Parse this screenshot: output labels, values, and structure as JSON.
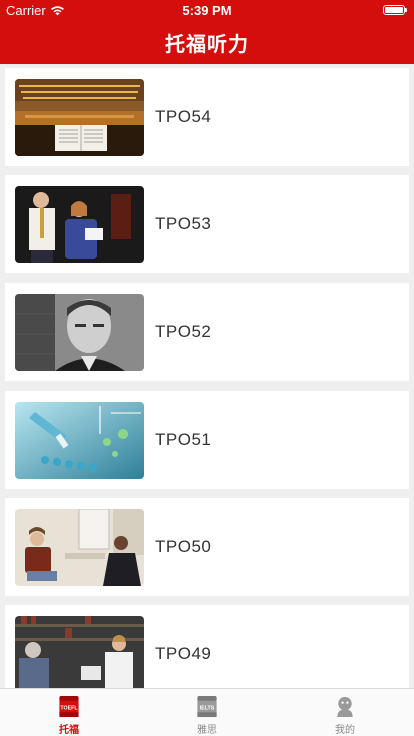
{
  "status": {
    "carrier": "Carrier",
    "time": "5:39 PM"
  },
  "header": {
    "title": "托福听力"
  },
  "items": [
    {
      "label": "TPO54",
      "image": "concert-hall-sheet-music"
    },
    {
      "label": "TPO53",
      "image": "students-conversation"
    },
    {
      "label": "TPO52",
      "image": "professor-portrait"
    },
    {
      "label": "TPO51",
      "image": "lab-research"
    },
    {
      "label": "TPO50",
      "image": "office-discussion"
    },
    {
      "label": "TPO49",
      "image": "library-students"
    }
  ],
  "tabs": [
    {
      "label": "托福",
      "icon": "toefl-book-icon",
      "icon_text": "TOEFL",
      "active": true
    },
    {
      "label": "雅思",
      "icon": "ielts-book-icon",
      "icon_text": "IELTS",
      "active": false
    },
    {
      "label": "我的",
      "icon": "profile-icon",
      "active": false
    }
  ],
  "colors": {
    "accent": "#d40d0d",
    "background": "#efefef"
  }
}
